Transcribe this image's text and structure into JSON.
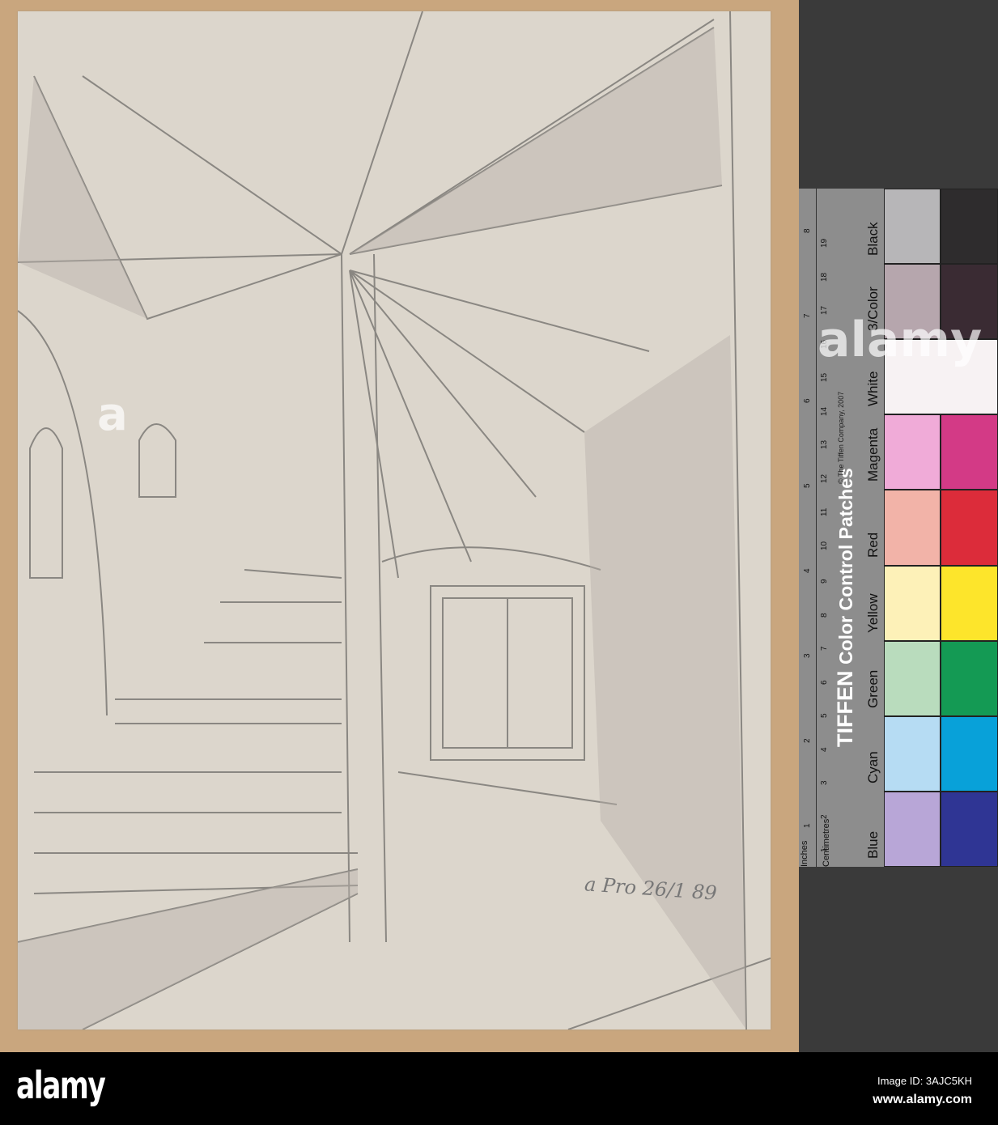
{
  "drawing": {
    "signature": "a Pro 26/1 89"
  },
  "color_chart": {
    "brand": "TIFFEN",
    "title": "Color Control Patches",
    "copyright": "© The Tiffen Company, 2007",
    "ruler_labels": {
      "inches": "Inches",
      "centimetres": "Centimetres"
    },
    "inch_ticks": [
      "1",
      "2",
      "3",
      "4",
      "5",
      "6",
      "7",
      "8"
    ],
    "cm_ticks": [
      "1",
      "2",
      "3",
      "4",
      "5",
      "6",
      "7",
      "8",
      "9",
      "10",
      "11",
      "12",
      "13",
      "14",
      "15",
      "16",
      "17",
      "18",
      "19"
    ],
    "patches": [
      {
        "label": "Black",
        "light": "#b7b6b8",
        "dark": "#2e2c2d"
      },
      {
        "label": "3/Color",
        "light": "#b6a6ad",
        "dark": "#3a2b33"
      },
      {
        "label": "White",
        "light": "#f7f2f3",
        "dark": "#f7f2f3"
      },
      {
        "label": "Magenta",
        "light": "#f0abd8",
        "dark": "#d33a86"
      },
      {
        "label": "Red",
        "light": "#f2b3a8",
        "dark": "#dc2c3a"
      },
      {
        "label": "Yellow",
        "light": "#fdf1b8",
        "dark": "#fde52b"
      },
      {
        "label": "Green",
        "light": "#b9dcbd",
        "dark": "#149a54"
      },
      {
        "label": "Cyan",
        "light": "#b6dcf3",
        "dark": "#08a1d9"
      },
      {
        "label": "Blue",
        "light": "#b8a6d7",
        "dark": "#2f3594"
      }
    ]
  },
  "watermark": {
    "text": "alamy",
    "glyph": "a"
  },
  "footer": {
    "logo": "alamy",
    "image_id": "Image ID: 3AJC5KH",
    "site": "www.alamy.com"
  }
}
